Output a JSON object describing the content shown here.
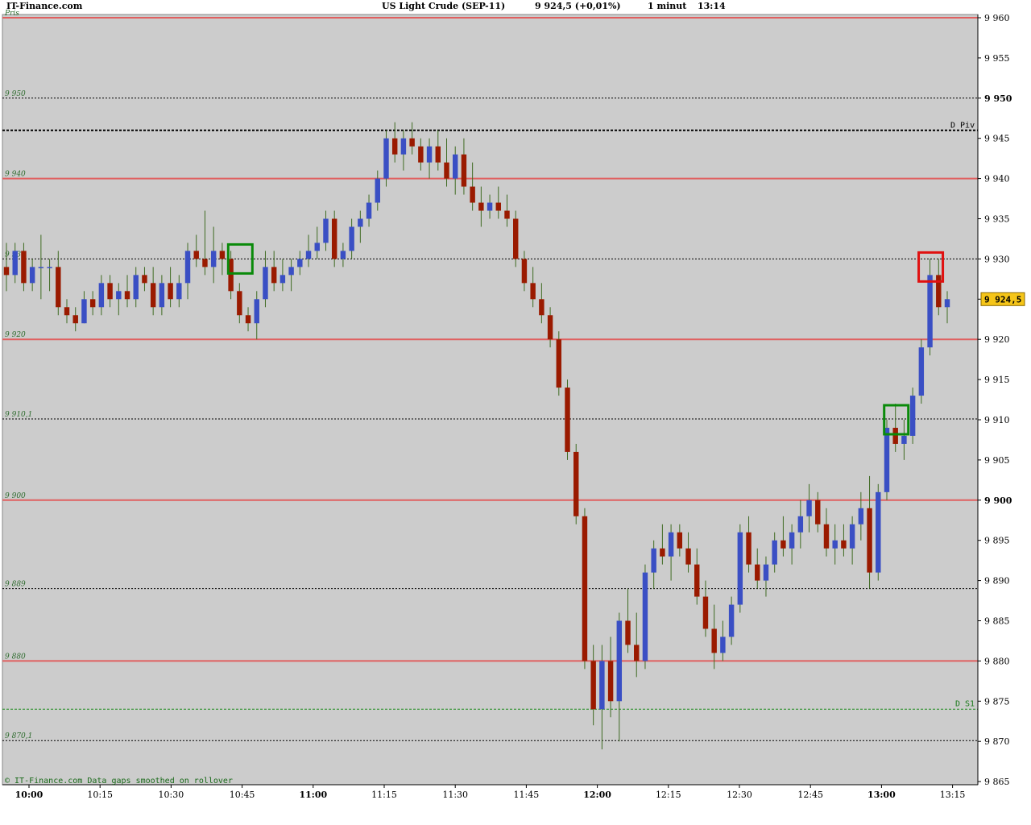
{
  "header": {
    "site": "IT-Finance.com",
    "instrument": "US Light Crude (SEP-11)",
    "quote": "9 924,5 (+0,01%)",
    "interval": "1 minut",
    "time": "13:14"
  },
  "footer_note": "© IT-Finance.com Data gaps smoothed on rollover",
  "last_price_label": "9 924,5",
  "colors": {
    "background": "#cccccc",
    "up_candle": "#3a4fc4",
    "down_candle": "#9a1a00",
    "wick": "#3f6b22",
    "level_line": "#e06060",
    "price_tag": "#f5c518",
    "box_green": "#0a8a0a",
    "box_red": "#e01010"
  },
  "chart_data": {
    "type": "candlestick",
    "ylim": [
      9864,
      9961
    ],
    "x_ticks": [
      {
        "label": "10:00",
        "bold": true
      },
      {
        "label": "10:15",
        "bold": false
      },
      {
        "label": "10:30",
        "bold": false
      },
      {
        "label": "10:45",
        "bold": false
      },
      {
        "label": "11:00",
        "bold": true
      },
      {
        "label": "11:15",
        "bold": false
      },
      {
        "label": "11:30",
        "bold": false
      },
      {
        "label": "11:45",
        "bold": false
      },
      {
        "label": "12:00",
        "bold": true
      },
      {
        "label": "12:15",
        "bold": false
      },
      {
        "label": "12:30",
        "bold": false
      },
      {
        "label": "12:45",
        "bold": false
      },
      {
        "label": "13:00",
        "bold": true
      },
      {
        "label": "13:15",
        "bold": false
      }
    ],
    "y_ticks": [
      {
        "label": "9 960",
        "value": 9960,
        "bold": false
      },
      {
        "label": "9 955",
        "value": 9955,
        "bold": false
      },
      {
        "label": "9 950",
        "value": 9950,
        "bold": true
      },
      {
        "label": "9 945",
        "value": 9945,
        "bold": false
      },
      {
        "label": "9 940",
        "value": 9940,
        "bold": false
      },
      {
        "label": "9 935",
        "value": 9935,
        "bold": false
      },
      {
        "label": "9 930",
        "value": 9930,
        "bold": false
      },
      {
        "label": "9 925",
        "value": 9925,
        "bold": false
      },
      {
        "label": "9 920",
        "value": 9920,
        "bold": false
      },
      {
        "label": "9 915",
        "value": 9915,
        "bold": false
      },
      {
        "label": "9 910",
        "value": 9910,
        "bold": false
      },
      {
        "label": "9 905",
        "value": 9905,
        "bold": false
      },
      {
        "label": "9 900",
        "value": 9900,
        "bold": true
      },
      {
        "label": "9 895",
        "value": 9895,
        "bold": false
      },
      {
        "label": "9 890",
        "value": 9890,
        "bold": false
      },
      {
        "label": "9 885",
        "value": 9885,
        "bold": false
      },
      {
        "label": "9 880",
        "value": 9880,
        "bold": false
      },
      {
        "label": "9 875",
        "value": 9875,
        "bold": false
      },
      {
        "label": "9 870",
        "value": 9870,
        "bold": false
      },
      {
        "label": "9 865",
        "value": 9865,
        "bold": false
      }
    ],
    "levels": [
      {
        "label": "Pris",
        "value": 9960,
        "style": "solid"
      },
      {
        "label": "9 950",
        "value": 9950,
        "style": "dotted"
      },
      {
        "label": "9 940",
        "value": 9940,
        "style": "solid"
      },
      {
        "label": "9 930",
        "value": 9930,
        "style": "dotted"
      },
      {
        "label": "9 920",
        "value": 9920,
        "style": "solid"
      },
      {
        "label": "9 910,1",
        "value": 9910.1,
        "style": "dotted"
      },
      {
        "label": "9 900",
        "value": 9900,
        "style": "solid"
      },
      {
        "label": "9 889",
        "value": 9889,
        "style": "dotted"
      },
      {
        "label": "9 880",
        "value": 9880,
        "style": "solid"
      },
      {
        "label": "9 870,1",
        "value": 9870.1,
        "style": "dotted"
      }
    ],
    "pivot": {
      "label": "D Piv",
      "value": 9946
    },
    "support1": {
      "label": "D S1",
      "value": 9874
    },
    "candles_ohlc": [
      [
        9929,
        9932,
        9926,
        9928
      ],
      [
        9928,
        9932,
        9927,
        9931
      ],
      [
        9931,
        9932,
        9926,
        9927
      ],
      [
        9927,
        9930,
        9926,
        9929
      ],
      [
        9929,
        9933,
        9925,
        9929
      ],
      [
        9929,
        9930,
        9926,
        9929
      ],
      [
        9929,
        9931,
        9923,
        9924
      ],
      [
        9924,
        9925,
        9922,
        9923
      ],
      [
        9923,
        9924,
        9921,
        9922
      ],
      [
        9922,
        9926,
        9922,
        9925
      ],
      [
        9925,
        9926,
        9923,
        9924
      ],
      [
        9924,
        9928,
        9923,
        9927
      ],
      [
        9927,
        9928,
        9924,
        9925
      ],
      [
        9925,
        9927,
        9923,
        9926
      ],
      [
        9926,
        9928,
        9924,
        9925
      ],
      [
        9925,
        9929,
        9924,
        9928
      ],
      [
        9928,
        9929,
        9926,
        9927
      ],
      [
        9927,
        9929,
        9923,
        9924
      ],
      [
        9924,
        9928,
        9923,
        9927
      ],
      [
        9927,
        9929,
        9924,
        9925
      ],
      [
        9925,
        9928,
        9924,
        9927
      ],
      [
        9927,
        9932,
        9925,
        9931
      ],
      [
        9931,
        9933,
        9929,
        9930
      ],
      [
        9930,
        9936,
        9928,
        9929
      ],
      [
        9929,
        9934,
        9927,
        9931
      ],
      [
        9931,
        9932,
        9928,
        9930
      ],
      [
        9930,
        9931,
        9925,
        9926
      ],
      [
        9926,
        9927,
        9922,
        9923
      ],
      [
        9923,
        9924,
        9921,
        9922
      ],
      [
        9922,
        9926,
        9920,
        9925
      ],
      [
        9925,
        9931,
        9924,
        9929
      ],
      [
        9929,
        9931,
        9926,
        9927
      ],
      [
        9927,
        9930,
        9926,
        9928
      ],
      [
        9928,
        9930,
        9926,
        9929
      ],
      [
        9929,
        9931,
        9928,
        9930
      ],
      [
        9930,
        9933,
        9929,
        9931
      ],
      [
        9931,
        9934,
        9930,
        9932
      ],
      [
        9932,
        9936,
        9931,
        9935
      ],
      [
        9935,
        9936,
        9929,
        9930
      ],
      [
        9930,
        9932,
        9929,
        9931
      ],
      [
        9931,
        9935,
        9930,
        9934
      ],
      [
        9934,
        9936,
        9932,
        9935
      ],
      [
        9935,
        9938,
        9934,
        9937
      ],
      [
        9937,
        9941,
        9936,
        9940
      ],
      [
        9940,
        9946,
        9939,
        9945
      ],
      [
        9945,
        9947,
        9942,
        9943
      ],
      [
        9943,
        9946,
        9941,
        9945
      ],
      [
        9945,
        9947,
        9943,
        9944
      ],
      [
        9944,
        9945,
        9941,
        9942
      ],
      [
        9942,
        9945,
        9940,
        9944
      ],
      [
        9944,
        9946,
        9941,
        9942
      ],
      [
        9942,
        9945,
        9939,
        9940
      ],
      [
        9940,
        9944,
        9938,
        9943
      ],
      [
        9943,
        9945,
        9938,
        9939
      ],
      [
        9939,
        9942,
        9936,
        9937
      ],
      [
        9937,
        9939,
        9934,
        9936
      ],
      [
        9936,
        9938,
        9935,
        9937
      ],
      [
        9937,
        9939,
        9935,
        9936
      ],
      [
        9936,
        9938,
        9934,
        9935
      ],
      [
        9935,
        9936,
        9929,
        9930
      ],
      [
        9930,
        9931,
        9926,
        9927
      ],
      [
        9927,
        9929,
        9924,
        9925
      ],
      [
        9925,
        9927,
        9922,
        9923
      ],
      [
        9923,
        9924,
        9919,
        9920
      ],
      [
        9920,
        9921,
        9913,
        9914
      ],
      [
        9914,
        9915,
        9905,
        9906
      ],
      [
        9906,
        9907,
        9897,
        9898
      ],
      [
        9898,
        9899,
        9879,
        9880
      ],
      [
        9880,
        9882,
        9872,
        9874
      ],
      [
        9874,
        9882,
        9869,
        9880
      ],
      [
        9880,
        9883,
        9873,
        9875
      ],
      [
        9875,
        9886,
        9870,
        9885
      ],
      [
        9885,
        9889,
        9881,
        9882
      ],
      [
        9882,
        9886,
        9878,
        9880
      ],
      [
        9880,
        9892,
        9879,
        9891
      ],
      [
        9891,
        9895,
        9889,
        9894
      ],
      [
        9894,
        9897,
        9892,
        9893
      ],
      [
        9893,
        9897,
        9890,
        9896
      ],
      [
        9896,
        9897,
        9893,
        9894
      ],
      [
        9894,
        9896,
        9891,
        9892
      ],
      [
        9892,
        9894,
        9887,
        9888
      ],
      [
        9888,
        9890,
        9883,
        9884
      ],
      [
        9884,
        9887,
        9879,
        9881
      ],
      [
        9881,
        9885,
        9880,
        9883
      ],
      [
        9883,
        9888,
        9882,
        9887
      ],
      [
        9887,
        9897,
        9886,
        9896
      ],
      [
        9896,
        9898,
        9891,
        9892
      ],
      [
        9892,
        9894,
        9889,
        9890
      ],
      [
        9890,
        9893,
        9888,
        9892
      ],
      [
        9892,
        9896,
        9891,
        9895
      ],
      [
        9895,
        9898,
        9893,
        9894
      ],
      [
        9894,
        9897,
        9892,
        9896
      ],
      [
        9896,
        9900,
        9894,
        9898
      ],
      [
        9898,
        9902,
        9896,
        9900
      ],
      [
        9900,
        9901,
        9896,
        9897
      ],
      [
        9897,
        9899,
        9893,
        9894
      ],
      [
        9894,
        9897,
        9892,
        9895
      ],
      [
        9895,
        9897,
        9893,
        9894
      ],
      [
        9894,
        9898,
        9892,
        9897
      ],
      [
        9897,
        9901,
        9895,
        9899
      ],
      [
        9899,
        9903,
        9889,
        9891
      ],
      [
        9891,
        9902,
        9890,
        9901
      ],
      [
        9901,
        9910,
        9900,
        9909
      ],
      [
        9909,
        9912,
        9906,
        9907
      ],
      [
        9907,
        9910,
        9905,
        9908
      ],
      [
        9908,
        9914,
        9907,
        9913
      ],
      [
        9913,
        9920,
        9912,
        9919
      ],
      [
        9919,
        9930,
        9918,
        9928
      ],
      [
        9928,
        9930,
        9923,
        9924
      ],
      [
        9924,
        9926,
        9922,
        9925
      ]
    ],
    "annotation_boxes": [
      {
        "color": "green",
        "value": 9930,
        "candle_index": 27
      },
      {
        "color": "green",
        "value": 9910,
        "candle_index": 103
      },
      {
        "color": "red",
        "value": 9929,
        "candle_index": 107
      }
    ]
  }
}
